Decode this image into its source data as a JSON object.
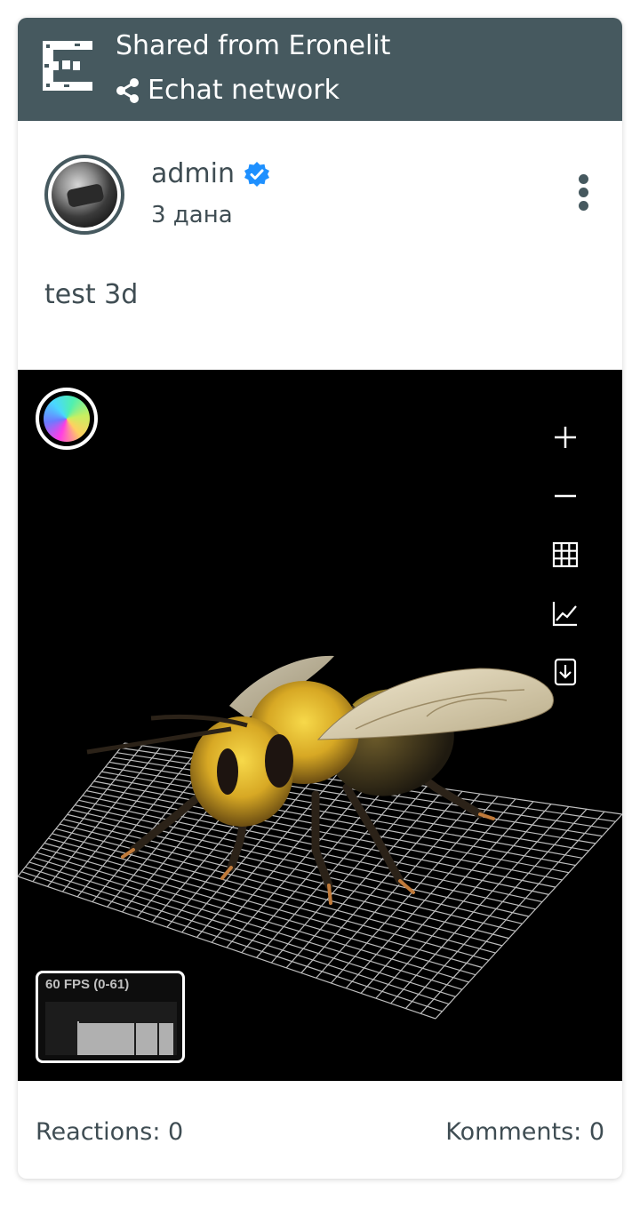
{
  "share": {
    "title": "Shared from Eronelit",
    "network": "Echat network"
  },
  "post": {
    "author": "admin",
    "time": "3 дана",
    "text": "test 3d"
  },
  "viewer": {
    "fps_label": "60 FPS (0-61)",
    "fps_value": 60,
    "tools": [
      "zoom-in",
      "zoom-out",
      "grid",
      "chart",
      "download"
    ]
  },
  "stats": {
    "reactions": "Reactions: 0",
    "comments": "Komments: 0"
  },
  "colors": {
    "header_bg": "#46595f",
    "text": "#3f4d53",
    "verified": "#1e90ff"
  }
}
